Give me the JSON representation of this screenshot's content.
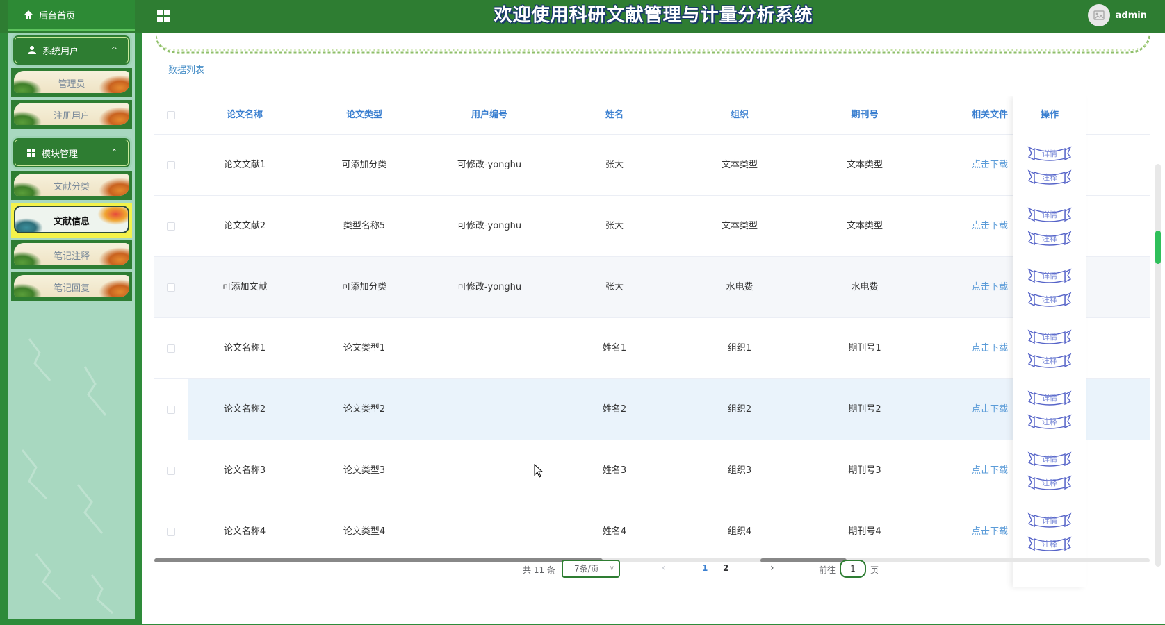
{
  "header": {
    "home_label": "后台首页",
    "title": "欢迎使用科研文献管理与计量分析系统",
    "username": "admin"
  },
  "sidebar": {
    "groups": [
      {
        "label": "系统用户",
        "icon": "user-icon",
        "items": [
          {
            "label": "管理员",
            "active": false
          },
          {
            "label": "注册用户",
            "active": false
          }
        ]
      },
      {
        "label": "模块管理",
        "icon": "grid-icon",
        "items": [
          {
            "label": "文献分类",
            "active": false
          },
          {
            "label": "文献信息",
            "active": true
          },
          {
            "label": "笔记注释",
            "active": false
          },
          {
            "label": "笔记回复",
            "active": false
          }
        ]
      }
    ]
  },
  "main": {
    "list_title": "数据列表",
    "columns": [
      "论文名称",
      "论文类型",
      "用户编号",
      "姓名",
      "组织",
      "期刊号",
      "相关文件",
      "操作"
    ],
    "rows": [
      {
        "name": "论文文献1",
        "type": "可添加分类",
        "user": "可修改-yonghu",
        "person": "张大",
        "org": "文本类型",
        "journal": "文本类型",
        "file": "点击下载"
      },
      {
        "name": "论文文献2",
        "type": "类型名称5",
        "user": "可修改-yonghu",
        "person": "张大",
        "org": "文本类型",
        "journal": "文本类型",
        "file": "点击下载"
      },
      {
        "name": "可添加文献",
        "type": "可添加分类",
        "user": "可修改-yonghu",
        "person": "张大",
        "org": "水电费",
        "journal": "水电费",
        "file": "点击下载"
      },
      {
        "name": "论文名称1",
        "type": "论文类型1",
        "user": "",
        "person": "姓名1",
        "org": "组织1",
        "journal": "期刊号1",
        "file": "点击下载"
      },
      {
        "name": "论文名称2",
        "type": "论文类型2",
        "user": "",
        "person": "姓名2",
        "org": "组织2",
        "journal": "期刊号2",
        "file": "点击下载"
      },
      {
        "name": "论文名称3",
        "type": "论文类型3",
        "user": "",
        "person": "姓名3",
        "org": "组织3",
        "journal": "期刊号3",
        "file": "点击下载"
      },
      {
        "name": "论文名称4",
        "type": "论文类型4",
        "user": "",
        "person": "姓名4",
        "org": "组织4",
        "journal": "期刊号4",
        "file": "点击下载"
      }
    ],
    "actions": {
      "detail": "详情",
      "note": "注释"
    }
  },
  "pagination": {
    "total_text": "共 11 条",
    "page_size": "7条/页",
    "pages": [
      "1",
      "2"
    ],
    "current_page": "1",
    "goto_label": "前往",
    "goto_value": "1",
    "goto_suffix": "页"
  },
  "colors": {
    "header_green": "#2e7d32",
    "sidebar_bg": "#a8d8c0",
    "header_link_blue": "#3a7fd0",
    "active_menu_yellow": "#f4f24a"
  }
}
